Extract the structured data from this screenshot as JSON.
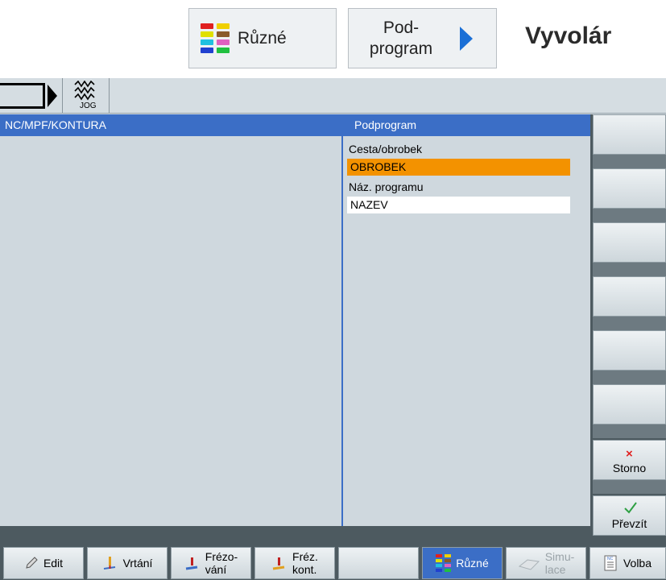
{
  "header": {
    "ruzne_button": "Různé",
    "podprogram_button": "Pod-\nprogram",
    "title": "Vyvolár"
  },
  "mode_bar": {
    "jog_label": "JOG"
  },
  "title_strip": {
    "path": "NC/MPF/KONTURA",
    "form_title": "Podprogram"
  },
  "form": {
    "path_label": "Cesta/obrobek",
    "path_value": "OBROBEK",
    "name_label": "Náz. programu",
    "name_value": "NAZEV"
  },
  "vertical_softkeys": [
    "",
    "",
    "",
    "",
    "",
    "",
    "Storno",
    "Převzít"
  ],
  "horizontal_softkeys": {
    "edit": "Edit",
    "vrtani": "Vrtání",
    "frezovani": "Frézo-\nvání",
    "frez_kont": "Fréz.\nkont.",
    "empty": "",
    "ruzne": "Různé",
    "simulace": "Simu-\nlace",
    "volba": "Volba"
  },
  "colors": {
    "accent_blue": "#3b6ec6",
    "highlight_orange": "#f39200",
    "storno_red": "#e02020",
    "confirm_green": "#2ea043"
  },
  "icons": {
    "ruzne": "colored-grid-icon",
    "edit": "pencil-icon",
    "vrtani": "drill-icon",
    "frezovani": "mill-icon",
    "frez_kont": "contour-mill-icon",
    "simulace": "simulation-icon",
    "volba": "nc-document-icon"
  }
}
